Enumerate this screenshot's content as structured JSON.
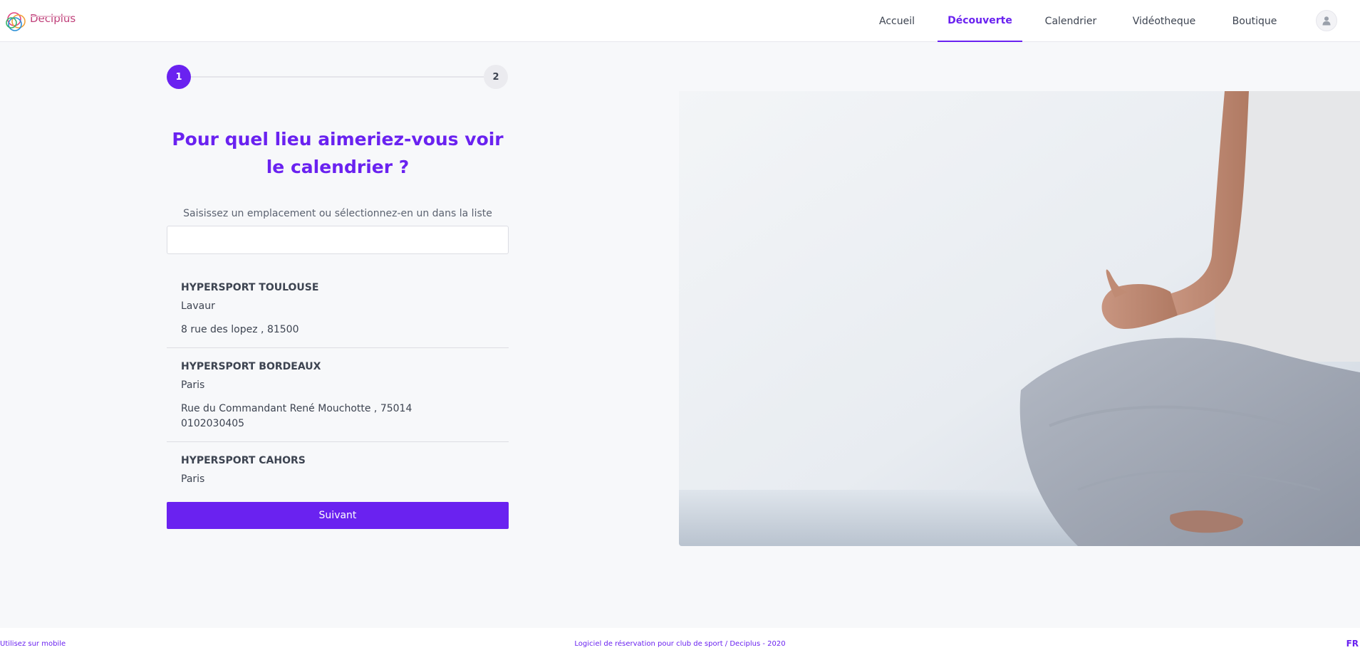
{
  "brand": {
    "name": "Deciplus"
  },
  "nav": {
    "items": [
      {
        "label": "Accueil",
        "active": false
      },
      {
        "label": "Découverte",
        "active": true
      },
      {
        "label": "Calendrier",
        "active": false
      },
      {
        "label": "Vidéotheque",
        "active": false
      },
      {
        "label": "Boutique",
        "active": false
      }
    ],
    "profile_icon": "user-icon"
  },
  "stepper": {
    "steps": [
      "1",
      "2"
    ],
    "current": 1
  },
  "form": {
    "question": "Pour quel lieu aimeriez-vous voir le calendrier ?",
    "hint": "Saisissez un emplacement ou sélectionnez-en un dans la liste",
    "search_value": "",
    "next_label": "Suivant"
  },
  "locations": [
    {
      "name": "HYPERSPORT TOULOUSE",
      "city": "Lavaur",
      "address": "8 rue des lopez , 81500",
      "phone": ""
    },
    {
      "name": "HYPERSPORT BORDEAUX",
      "city": "Paris",
      "address": "Rue du Commandant René Mouchotte , 75014",
      "phone": "0102030405"
    },
    {
      "name": "HYPERSPORT CAHORS",
      "city": "Paris",
      "address": "",
      "phone": ""
    }
  ],
  "footer": {
    "mobile_link": "Utilisez sur mobile",
    "copyright": "Logiciel de réservation pour club de sport / Deciplus - 2020",
    "language": "FR"
  },
  "colors": {
    "accent": "#6a22f0",
    "text": "#3d4451",
    "background": "#f7f8fa"
  }
}
